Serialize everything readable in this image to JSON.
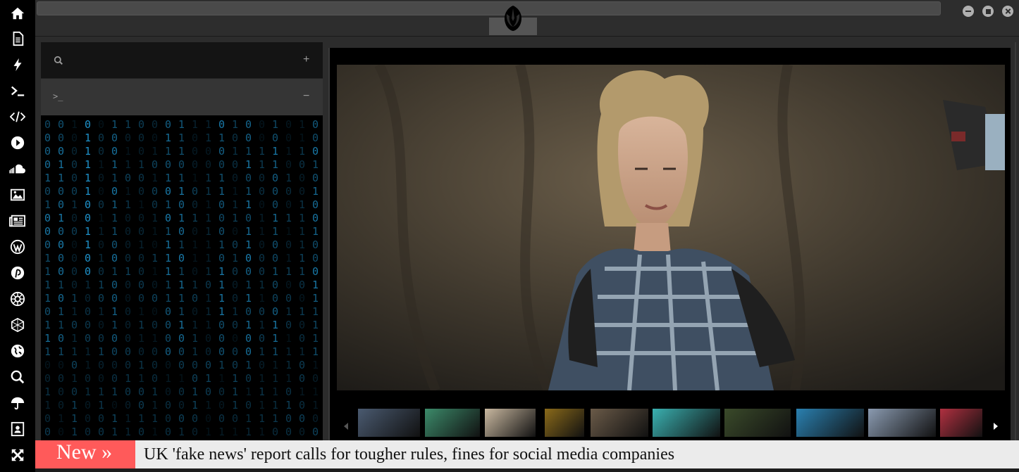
{
  "sidebar": {
    "items": [
      {
        "icon": "home-icon",
        "name": "sidebar-home"
      },
      {
        "icon": "document-icon",
        "name": "sidebar-documents"
      },
      {
        "icon": "bolt-icon",
        "name": "sidebar-bolt"
      },
      {
        "icon": "terminal-icon",
        "name": "sidebar-terminal"
      },
      {
        "icon": "code-icon",
        "name": "sidebar-code"
      },
      {
        "icon": "play-circle-icon",
        "name": "sidebar-media"
      },
      {
        "icon": "soundcloud-icon",
        "name": "sidebar-soundcloud"
      },
      {
        "icon": "image-icon",
        "name": "sidebar-images"
      },
      {
        "icon": "newspaper-icon",
        "name": "sidebar-news"
      },
      {
        "icon": "wordpress-icon",
        "name": "sidebar-wordpress"
      },
      {
        "icon": "pinterest-icon",
        "name": "sidebar-pinterest"
      },
      {
        "icon": "empire-icon",
        "name": "sidebar-empire"
      },
      {
        "icon": "hexagon-network-icon",
        "name": "sidebar-network"
      },
      {
        "icon": "globe-icon",
        "name": "sidebar-globe"
      },
      {
        "icon": "search-icon",
        "name": "sidebar-search"
      },
      {
        "icon": "umbrella-icon",
        "name": "sidebar-umbrella"
      },
      {
        "icon": "contact-card-icon",
        "name": "sidebar-contacts"
      },
      {
        "icon": "fullscreen-icon",
        "name": "sidebar-fullscreen"
      }
    ]
  },
  "topbar": {
    "logo_icon": "rebel-alliance-icon",
    "window_controls": [
      "minimize",
      "maximize",
      "close"
    ]
  },
  "panel": {
    "search_icon": "search-icon",
    "add_symbol": "+",
    "prompt_symbol": ">_",
    "collapse_symbol": "−",
    "matrix_color": "#1e90c8"
  },
  "viewer": {
    "thumbnails": [
      {
        "name": "thumb-1",
        "color": "#4a5a70"
      },
      {
        "name": "thumb-2",
        "color": "#3c8a6a"
      },
      {
        "name": "thumb-3",
        "color": "#c9b8a0"
      },
      {
        "name": "thumb-4",
        "color": "#8a6a1a"
      },
      {
        "name": "thumb-5",
        "color": "#6a5a48"
      },
      {
        "name": "thumb-6",
        "color": "#3ab0b0"
      },
      {
        "name": "thumb-7",
        "color": "#3a4a2a"
      },
      {
        "name": "thumb-8",
        "color": "#2a80b0"
      },
      {
        "name": "thumb-9",
        "color": "#8a9ab0"
      },
      {
        "name": "thumb-10",
        "color": "#b03040"
      }
    ]
  },
  "ticker": {
    "tag": "New »",
    "headline": "UK 'fake news' report calls for tougher rules, fines for social media companies",
    "tag_color": "#ff5a5a"
  }
}
